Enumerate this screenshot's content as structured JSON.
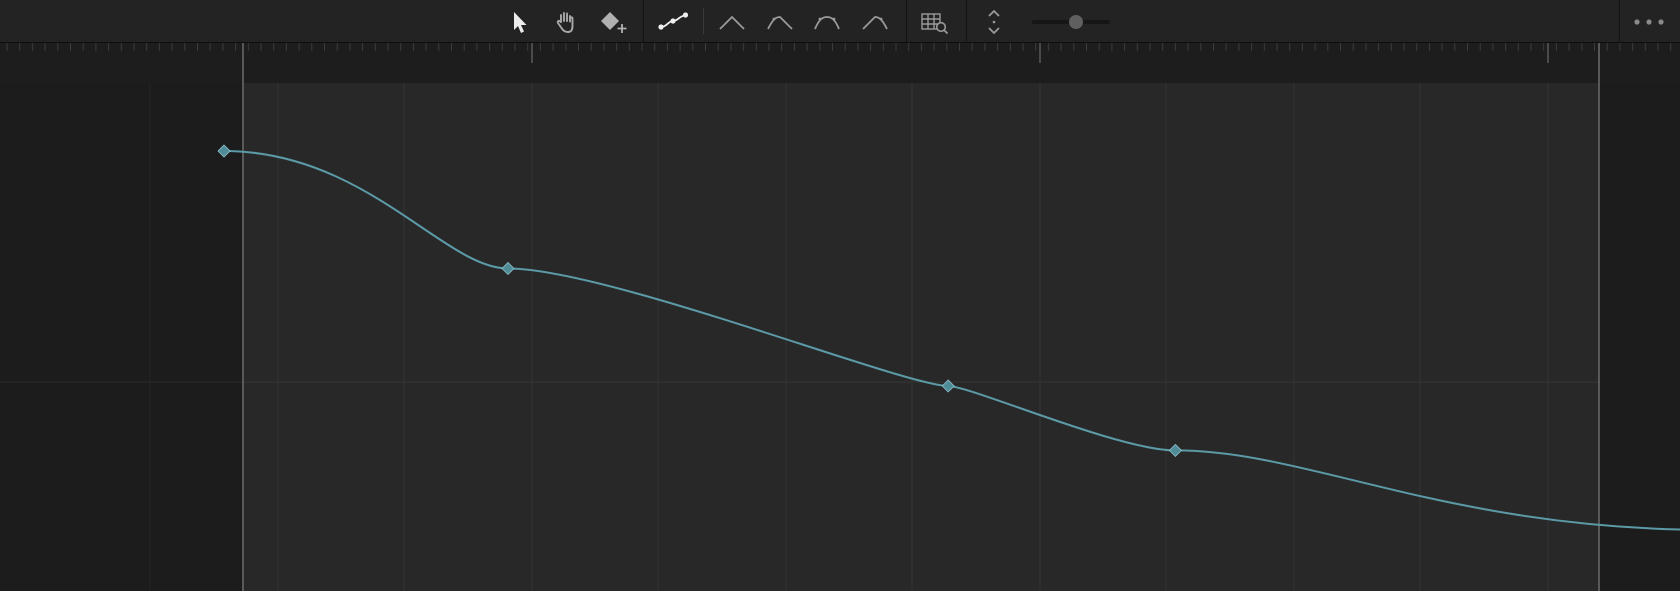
{
  "toolbar": {
    "tools": [
      {
        "name": "select-tool-button",
        "icon": "pointer-arrow-icon",
        "active": true
      },
      {
        "name": "pan-tool-button",
        "icon": "hand-icon",
        "active": false
      },
      {
        "name": "add-keyframe-button",
        "icon": "diamond-plus-icon",
        "active": false
      }
    ],
    "curve_modes": [
      {
        "name": "bezier-curve-button",
        "icon": "bezier-curve-icon",
        "active": true
      },
      {
        "name": "linear-interpolation-button",
        "icon": "linear-peak-icon"
      },
      {
        "name": "ease-in-button",
        "icon": "ease-in-icon"
      },
      {
        "name": "ease-in-out-button",
        "icon": "ease-in-out-icon"
      },
      {
        "name": "ease-out-button",
        "icon": "ease-out-icon"
      }
    ],
    "zoom_to_fit_icon": "grid-magnifier-icon",
    "vertical_fit_icon": "vertical-expand-icon",
    "zoom_slider": {
      "value": 0.57
    },
    "more_icon": "more-dots-icon"
  },
  "colors": {
    "curve": "#5b9aa6",
    "keyframe": "#4f8c98",
    "active_region": "#282828",
    "outside_region": "#1d1d1d"
  },
  "curve_keyframes": [
    {
      "t": 0.0,
      "v": 1.0
    },
    {
      "t": 0.2,
      "v": 0.69
    },
    {
      "t": 0.51,
      "v": 0.38
    },
    {
      "t": 0.67,
      "v": 0.21
    },
    {
      "t": 1.05,
      "v": 0.0
    }
  ]
}
